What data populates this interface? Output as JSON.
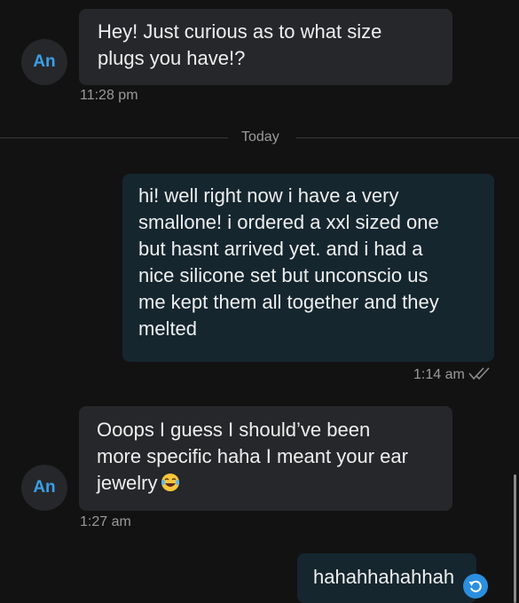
{
  "messages": {
    "m1": {
      "avatar": "An",
      "lines": [
        "Hey! Just curious as to what size",
        "plugs you have!?"
      ],
      "time": "11:28 pm"
    },
    "divider": "Today",
    "m2": {
      "lines": [
        "hi! well right now i have a very",
        "smallone! i ordered a xxl sized one",
        "but hasnt arrived yet. and i had a",
        "nice silicone set but unconscio us",
        "me kept them all together and they",
        "melted"
      ],
      "time": "1:14 am",
      "status_icon": "double-check-icon"
    },
    "m3": {
      "avatar": "An",
      "lines": [
        "Ooops I guess I should’ve been",
        "more specific haha I meant your ear",
        "jewelry"
      ],
      "emoji": "face-with-tears-of-joy",
      "time": "1:27 am"
    },
    "m4": {
      "lines": [
        "hahahhahahhah"
      ],
      "status_icon": "retry-icon"
    }
  },
  "colors": {
    "background": "#121212",
    "incoming_bubble": "#26272a",
    "outgoing_bubble": "#15262f",
    "avatar_text": "#3aa0e8",
    "accent": "#2b8fe0"
  }
}
